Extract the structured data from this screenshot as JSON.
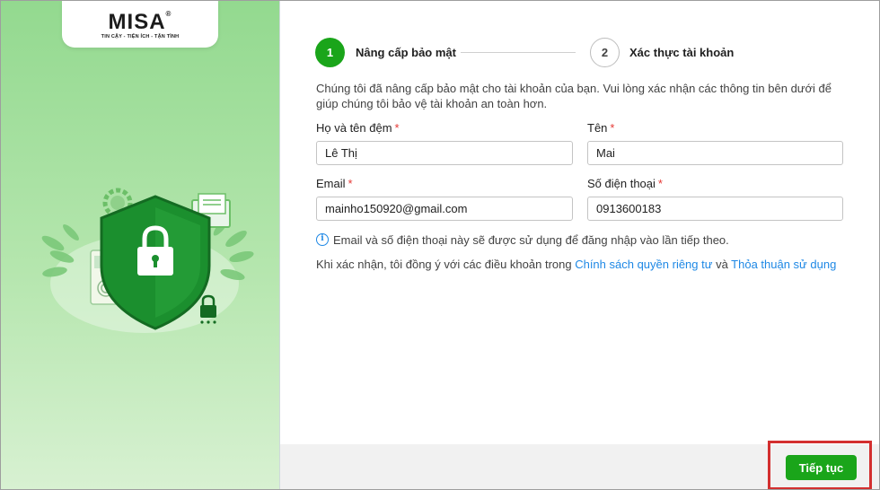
{
  "brand": {
    "logo_text": "MISA",
    "logo_reg": "®",
    "tagline": "TIN CẬY - TIỆN ÍCH - TẬN TÌNH"
  },
  "stepper": {
    "steps": [
      {
        "number": "1",
        "label": "Nâng cấp bảo mật",
        "active": true
      },
      {
        "number": "2",
        "label": "Xác thực tài khoản",
        "active": false
      }
    ]
  },
  "intro_text": "Chúng tôi đã nâng cấp bảo mật cho tài khoản của bạn. Vui lòng xác nhận các thông tin bên dưới để giúp chúng tôi bảo vệ tài khoản an toàn hơn.",
  "form": {
    "required_mark": "*",
    "middle_name": {
      "label": "Họ và tên đệm",
      "value": "Lê Thị"
    },
    "first_name": {
      "label": "Tên",
      "value": "Mai"
    },
    "email": {
      "label": "Email",
      "value": "mainho150920@gmail.com"
    },
    "phone": {
      "label": "Số điện thoại",
      "value": "0913600183"
    }
  },
  "info_note": "Email và số điện thoại này sẽ được sử dụng để đăng nhập vào lần tiếp theo.",
  "terms": {
    "prefix": "Khi xác nhận, tôi đồng ý với các điều khoản trong ",
    "privacy_link": "Chính sách quyền riêng tư",
    "conjunction": " và ",
    "usage_link": "Thỏa thuận sử dụng"
  },
  "footer": {
    "continue_label": "Tiếp tục"
  },
  "colors": {
    "primary_green": "#1aa51a",
    "link_blue": "#1e88e5",
    "required_red": "#e53935",
    "highlight_red": "#d32f2f"
  }
}
